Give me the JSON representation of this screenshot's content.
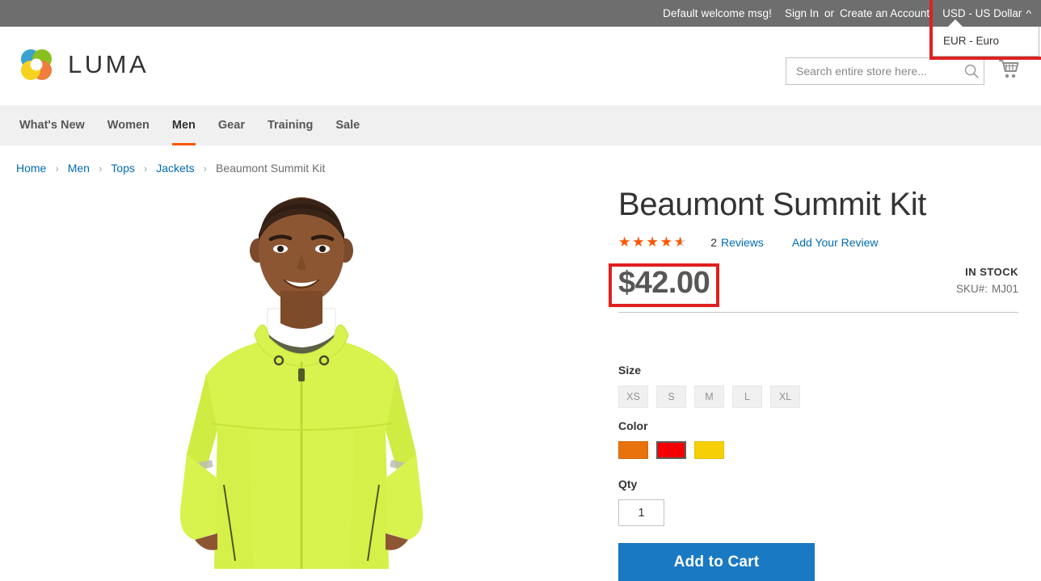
{
  "top_panel": {
    "welcome_message": "Default welcome msg!",
    "sign_in_label": "Sign In",
    "or_label": "or",
    "create_account_label": "Create an Account",
    "currency": {
      "selected": "USD - US Dollar",
      "caret_icon": "chevron-up-icon",
      "options": [
        "EUR - Euro"
      ]
    }
  },
  "header": {
    "logo_text": "LUMA",
    "logo_icon": "luma-circles-logo",
    "search": {
      "placeholder": "Search entire store here...",
      "value": "",
      "icon": "search-icon"
    },
    "cart": {
      "icon": "shopping-cart-icon"
    }
  },
  "nav": {
    "items": [
      {
        "label": "What's New",
        "active": false
      },
      {
        "label": "Women",
        "active": false
      },
      {
        "label": "Men",
        "active": true
      },
      {
        "label": "Gear",
        "active": false
      },
      {
        "label": "Training",
        "active": false
      },
      {
        "label": "Sale",
        "active": false
      }
    ]
  },
  "breadcrumbs": {
    "separator": "›",
    "items": [
      {
        "label": "Home",
        "current": false
      },
      {
        "label": "Men",
        "current": false
      },
      {
        "label": "Tops",
        "current": false
      },
      {
        "label": "Jackets",
        "current": false
      },
      {
        "label": "Beaumont Summit Kit",
        "current": true
      }
    ]
  },
  "product": {
    "title": "Beaumont Summit Kit",
    "rating": {
      "value": 4.5,
      "max": 5,
      "percent": 90,
      "stars_glyphs": "★★★★★"
    },
    "reviews_count": "2",
    "reviews_label": "Reviews",
    "add_review_label": "Add Your Review",
    "price": "$42.00",
    "stock_status": "IN STOCK",
    "sku_label": "SKU#:",
    "sku_value": "MJ01",
    "size": {
      "label": "Size",
      "options": [
        "XS",
        "S",
        "M",
        "L",
        "XL"
      ]
    },
    "color": {
      "label": "Color",
      "options": [
        {
          "name": "orange",
          "hex": "#e8720c",
          "selected": false
        },
        {
          "name": "red",
          "hex": "#f40000",
          "selected": true
        },
        {
          "name": "yellow",
          "hex": "#f7cf06",
          "selected": false
        }
      ]
    },
    "qty": {
      "label": "Qty",
      "value": "1"
    },
    "add_to_cart_label": "Add to Cart",
    "image_alt": "Man wearing lime green Beaumont Summit Kit jacket"
  },
  "annotations": [
    {
      "name": "currency-switcher-highlight",
      "color": "#e02020"
    },
    {
      "name": "price-highlight",
      "color": "#e02020"
    }
  ],
  "colors": {
    "top_panel_bg": "#6e6e6e",
    "nav_bg": "#f0f0f0",
    "accent_orange": "#ff5501",
    "link_blue": "#006bb4",
    "button_blue": "#1979c3",
    "annotation_red": "#e02020"
  }
}
